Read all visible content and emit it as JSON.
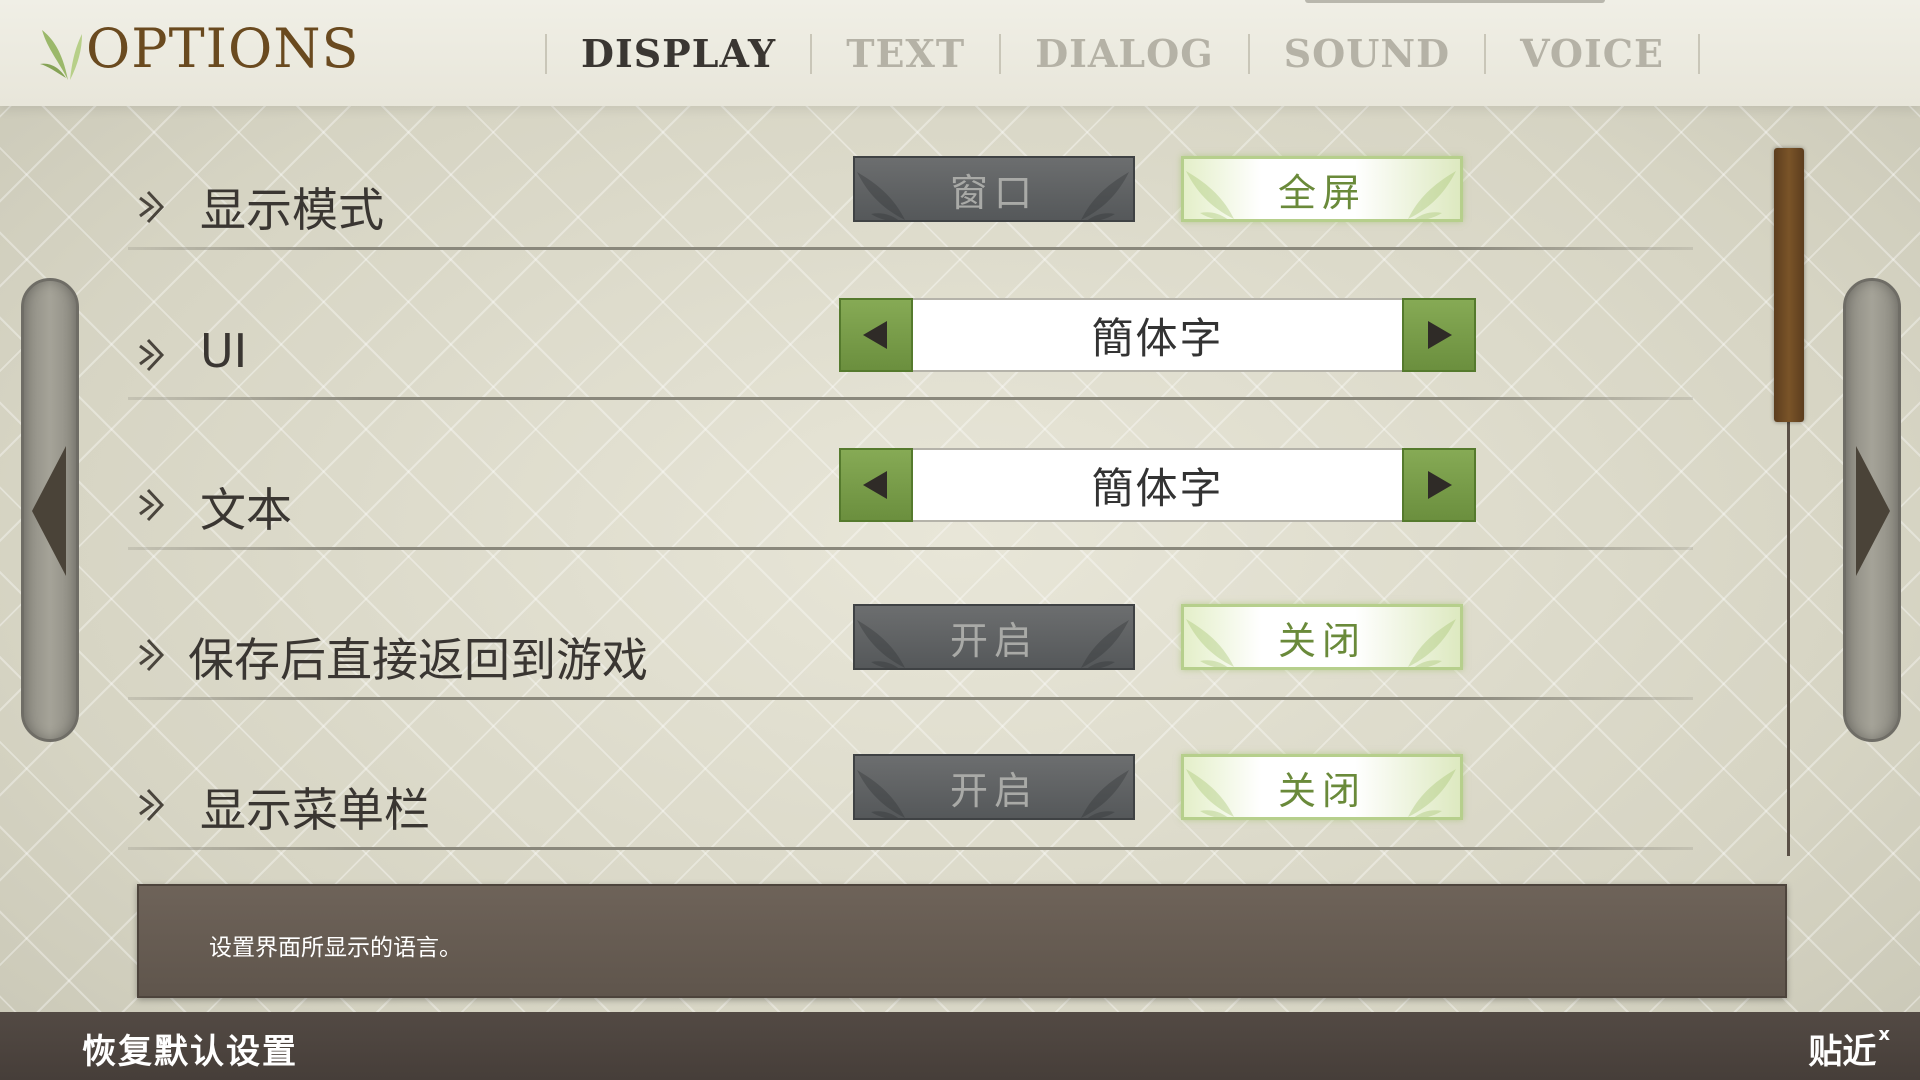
{
  "header": {
    "title": "OPTIONS",
    "tabs": [
      {
        "label": "DISPLAY",
        "active": true
      },
      {
        "label": "TEXT",
        "active": false
      },
      {
        "label": "DIALOG",
        "active": false
      },
      {
        "label": "SOUND",
        "active": false
      },
      {
        "label": "VOICE",
        "active": false
      }
    ]
  },
  "options": {
    "display_mode": {
      "label": "显示模式",
      "option_a": "窗口",
      "option_b": "全屏",
      "selected": "全屏"
    },
    "ui_language": {
      "label": "UI",
      "value": "簡体字"
    },
    "text_language": {
      "label": "文本",
      "value": "簡体字"
    },
    "return_after_save": {
      "label": "保存后直接返回到游戏",
      "option_a": "开启",
      "option_b": "关闭",
      "selected": "关闭"
    },
    "show_menu_bar": {
      "label": "显示菜单栏",
      "option_a": "开启",
      "option_b": "关闭",
      "selected": "关闭"
    }
  },
  "description": "设置界面所显示的语言。",
  "footer": {
    "reset_label": "恢复默认设置",
    "right_label": "贴近",
    "close_glyph": "x"
  },
  "colors": {
    "accent_green": "#7a9d4a",
    "title_brown": "#6a4a1f",
    "scroll_thumb": "#6b4a24"
  }
}
